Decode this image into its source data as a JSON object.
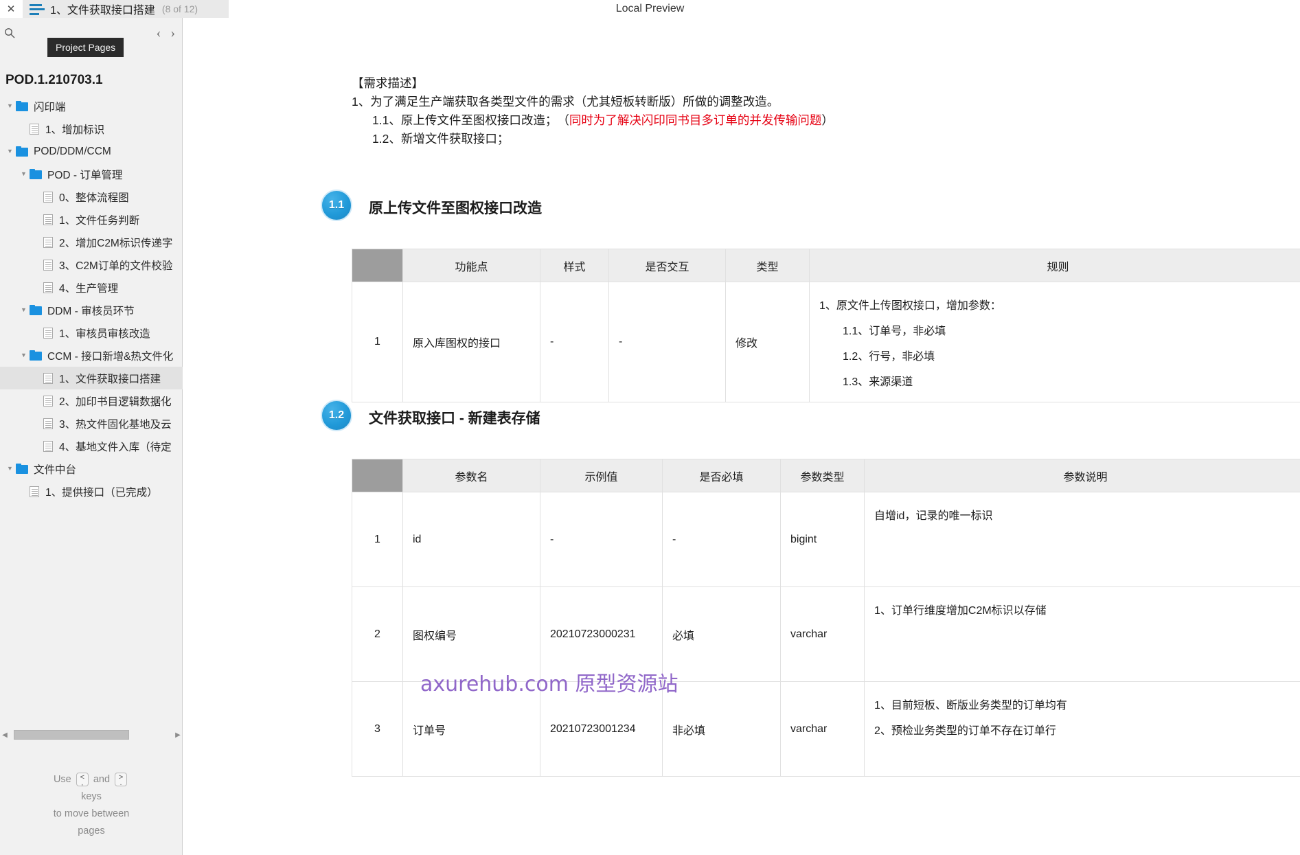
{
  "topbar": {
    "close_label": "✕",
    "tab_title": "1、文件获取接口搭建",
    "tab_count": "(8 of 12)",
    "window_title": "Local Preview"
  },
  "sidebar": {
    "tooltip": "Project Pages",
    "prev_arrow": "‹",
    "next_arrow": "›",
    "project_title": "POD.1.210703.1",
    "tree": [
      {
        "depth": 0,
        "type": "folder",
        "caret": "▼",
        "label": "闪印端",
        "selected": false
      },
      {
        "depth": 1,
        "type": "page",
        "caret": "",
        "label": "1、增加标识",
        "selected": false
      },
      {
        "depth": 0,
        "type": "folder",
        "caret": "▼",
        "label": "POD/DDM/CCM",
        "selected": false
      },
      {
        "depth": 1,
        "type": "folder",
        "caret": "▼",
        "label": "POD - 订单管理",
        "selected": false
      },
      {
        "depth": 2,
        "type": "page",
        "caret": "",
        "label": "0、整体流程图",
        "selected": false
      },
      {
        "depth": 2,
        "type": "page",
        "caret": "",
        "label": "1、文件任务判断",
        "selected": false
      },
      {
        "depth": 2,
        "type": "page",
        "caret": "",
        "label": "2、增加C2M标识传递字",
        "selected": false
      },
      {
        "depth": 2,
        "type": "page",
        "caret": "",
        "label": "3、C2M订单的文件校验",
        "selected": false
      },
      {
        "depth": 2,
        "type": "page",
        "caret": "",
        "label": "4、生产管理",
        "selected": false
      },
      {
        "depth": 1,
        "type": "folder",
        "caret": "▼",
        "label": "DDM - 审核员环节",
        "selected": false
      },
      {
        "depth": 2,
        "type": "page",
        "caret": "",
        "label": "1、审核员审核改造",
        "selected": false
      },
      {
        "depth": 1,
        "type": "folder",
        "caret": "▼",
        "label": "CCM - 接口新增&热文件化",
        "selected": false
      },
      {
        "depth": 2,
        "type": "page",
        "caret": "",
        "label": "1、文件获取接口搭建",
        "selected": true
      },
      {
        "depth": 2,
        "type": "page",
        "caret": "",
        "label": "2、加印书目逻辑数据化",
        "selected": false
      },
      {
        "depth": 2,
        "type": "page",
        "caret": "",
        "label": "3、热文件固化基地及云",
        "selected": false
      },
      {
        "depth": 2,
        "type": "page",
        "caret": "",
        "label": "4、基地文件入库（待定",
        "selected": false
      },
      {
        "depth": 0,
        "type": "folder",
        "caret": "▼",
        "label": "文件中台",
        "selected": false
      },
      {
        "depth": 1,
        "type": "page",
        "caret": "",
        "label": "1、提供接口（已完成）",
        "selected": false
      }
    ],
    "hint": {
      "use": "Use",
      "and": "and",
      "key_prev_top": "<",
      "key_prev_bottom": ",",
      "key_next_top": ">",
      "key_next_bottom": ".",
      "line2": "keys",
      "line3": "to move between",
      "line4": "pages"
    }
  },
  "document": {
    "requirement": {
      "heading": "【需求描述】",
      "line1": "1、为了满足生产端获取各类型文件的需求（尤其短板转断版）所做的调整改造。",
      "line2_black": "1.1、原上传文件至图权接口改造；　（",
      "line2_red": "同时为了解决闪印同书目多订单的并发传输问题",
      "line2_tail": "）",
      "line3": "1.2、新增文件获取接口；"
    },
    "section_1_1": {
      "badge": "1.1",
      "title": "原上传文件至图权接口改造",
      "columns": [
        "",
        "功能点",
        "样式",
        "是否交互",
        "类型",
        "规则"
      ],
      "rows": [
        {
          "idx": "1",
          "feature": "原入库图权的接口",
          "style": "-",
          "interactive": "-",
          "type": "修改",
          "rule_main": "1、原文件上传图权接口，增加参数：",
          "rule_subs": [
            "1.1、订单号，非必填",
            "1.2、行号，非必填",
            "1.3、来源渠道"
          ]
        }
      ]
    },
    "section_1_2": {
      "badge": "1.2",
      "title": "文件获取接口 - 新建表存储",
      "columns": [
        "",
        "参数名",
        "示例值",
        "是否必填",
        "参数类型",
        "参数说明"
      ],
      "rows": [
        {
          "idx": "1",
          "name": "id",
          "sample": "-",
          "required": "-",
          "type": "bigint",
          "desc_lines": [
            "自增id，记录的唯一标识"
          ]
        },
        {
          "idx": "2",
          "name": "图权编号",
          "sample": "20210723000231",
          "required": "必填",
          "type": "varchar",
          "desc_lines": [
            "1、订单行维度增加C2M标识以存储"
          ]
        },
        {
          "idx": "3",
          "name": "订单号",
          "sample": "20210723001234",
          "required": "非必填",
          "type": "varchar",
          "desc_lines": [
            "1、目前短板、断版业务类型的订单均有",
            "2、预检业务类型的订单不存在订单行"
          ]
        }
      ]
    },
    "watermark": "axurehub.com 原型资源站"
  }
}
